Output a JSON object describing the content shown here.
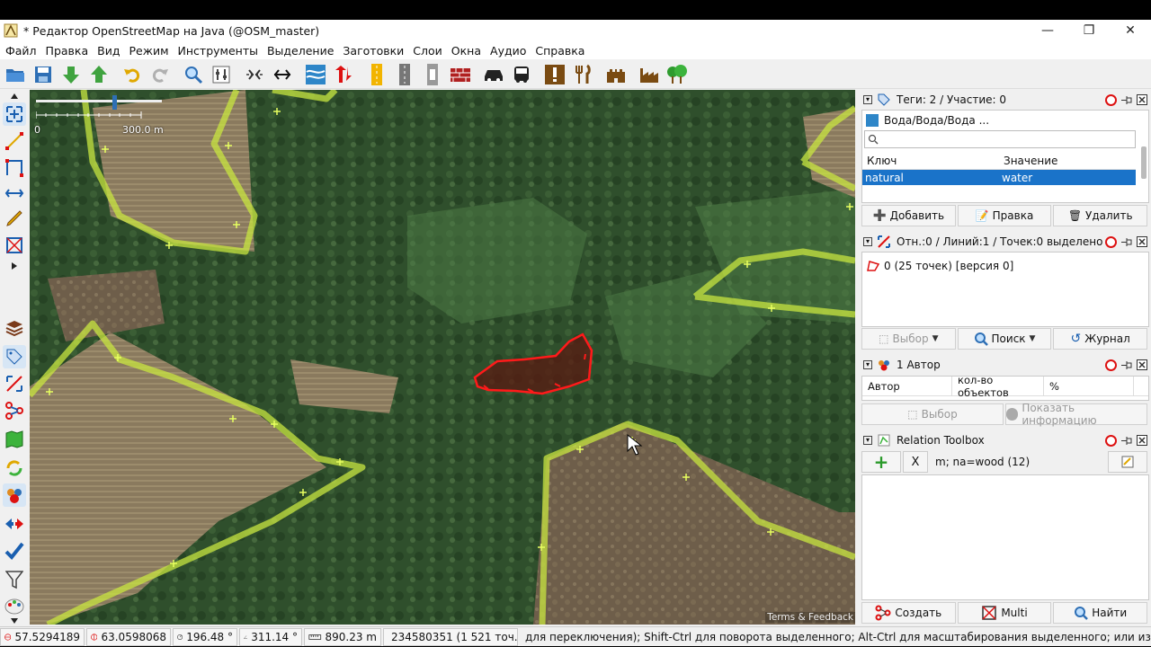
{
  "window": {
    "title": "* Редактор OpenStreetMap на Java (@OSM_master)",
    "minimize": "—",
    "maximize": "❐",
    "close": "✕"
  },
  "menu": [
    "Файл",
    "Правка",
    "Вид",
    "Режим",
    "Инструменты",
    "Выделение",
    "Заготовки",
    "Слои",
    "Окна",
    "Аудио",
    "Справка"
  ],
  "map": {
    "scale_start": "0",
    "scale_end": "300.0 m",
    "terms": "Terms & Feedback"
  },
  "tags_panel": {
    "title": "Теги: 2 / Участие: 0",
    "preset": "Вода/Вода/Вода ...",
    "col_key": "Ключ",
    "col_value": "Значение",
    "row_key": "natural",
    "row_value": "water",
    "add": "Добавить",
    "edit": "Правка",
    "delete": "Удалить"
  },
  "selection_panel": {
    "title": "Отн.:0 / Линий:1 / Точек:0 выделено",
    "item": "0 (25 точек) [версия 0]",
    "select": "Выбор",
    "search": "Поиск",
    "history": "Журнал"
  },
  "author_panel": {
    "title": "1 Автор",
    "col_author": "Автор",
    "col_count": "кол-во объектов",
    "col_percent": "%",
    "select": "Выбор",
    "show_info": "Показать информацию"
  },
  "relation_panel": {
    "title": "Relation Toolbox",
    "add": "+",
    "remove": "X",
    "relation": "m; na=wood (12)",
    "create": "Создать",
    "multi": "Multi",
    "find": "Найти"
  },
  "status": {
    "lat": "57.5294189",
    "lon": "63.0598068",
    "heading": "196.48 °",
    "angle": "311.14 °",
    "distance": "890.23 m",
    "way": "234580351 (1 521 точ...",
    "message": "для переключения); Shift-Ctrl для поворота выделенного; Alt-Ctrl для масштабирования выделенного; или изменения выделения."
  },
  "colors": {
    "selection": "#ff1a1a",
    "wood_outline": "#c8e640",
    "list_select": "#1a73c9"
  }
}
